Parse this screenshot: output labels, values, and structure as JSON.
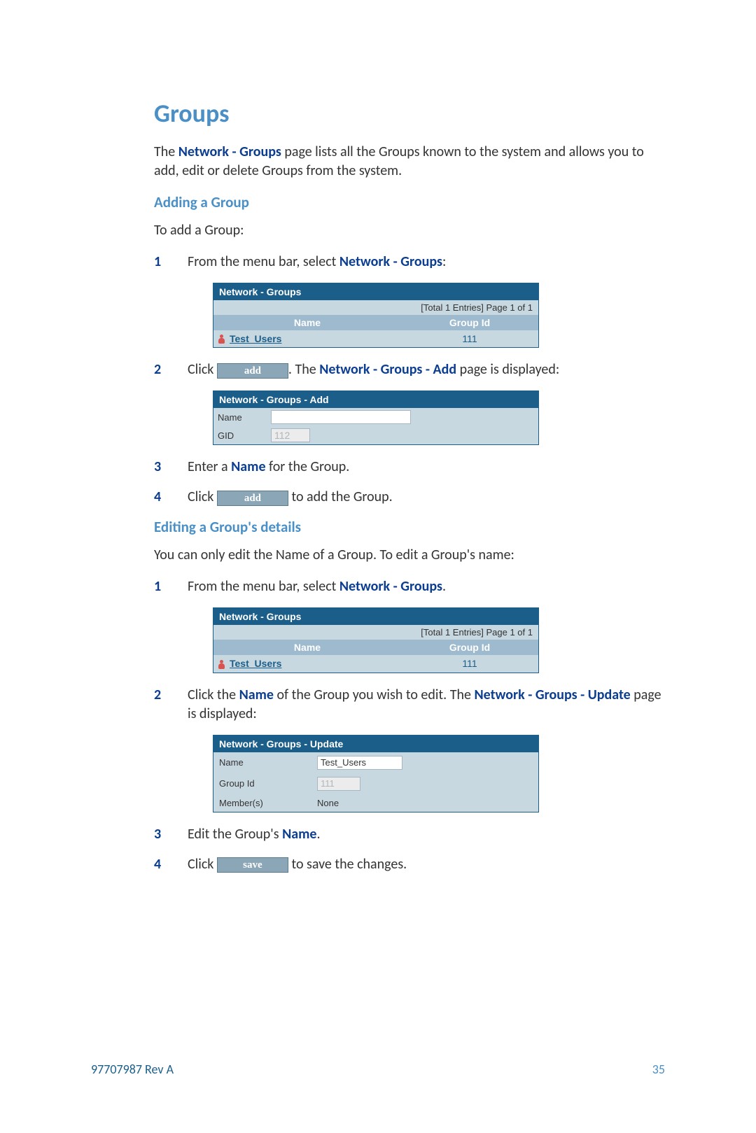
{
  "heading": "Groups",
  "intro": {
    "pre": "The ",
    "bold": "Network - Groups",
    "post": " page lists all the Groups known to the system and allows you to add, edit or delete Groups from the system."
  },
  "adding": {
    "title": "Adding a Group",
    "lead": "To add a Group:",
    "step1": {
      "num": "1",
      "pre": "From the menu bar, select ",
      "bold": "Network - Groups",
      "post": ":"
    },
    "panel1": {
      "title": "Network - Groups",
      "meta": "[Total 1 Entries] Page 1 of 1",
      "col_name": "Name",
      "col_gid": "Group Id",
      "row_name": "Test_Users",
      "row_gid": "111"
    },
    "step2": {
      "num": "2",
      "pre": "Click ",
      "btn": "add",
      "mid": ". The ",
      "bold": "Network - Groups - Add",
      "post": " page is displayed:"
    },
    "panel2": {
      "title": "Network - Groups - Add",
      "name_label": "Name",
      "gid_label": "GID",
      "gid_value": "112"
    },
    "step3": {
      "num": "3",
      "pre": "Enter a ",
      "bold": "Name",
      "post": " for the Group."
    },
    "step4": {
      "num": "4",
      "pre": "Click ",
      "btn": "add",
      "post": " to add the Group."
    }
  },
  "editing": {
    "title": "Editing a Group's details",
    "lead": "You can only edit the Name of a Group. To edit a Group's name:",
    "step1": {
      "num": "1",
      "pre": "From the menu bar, select ",
      "bold": "Network - Groups",
      "post": "."
    },
    "panel1": {
      "title": "Network - Groups",
      "meta": "[Total 1 Entries] Page 1 of 1",
      "col_name": "Name",
      "col_gid": "Group Id",
      "row_name": "Test_Users",
      "row_gid": "111"
    },
    "step2": {
      "num": "2",
      "pre": "Click the ",
      "bold1": "Name",
      "mid": " of the Group you wish to edit. The ",
      "bold2": "Network - Groups - Update",
      "post": " page is displayed:"
    },
    "panel2": {
      "title": "Network - Groups - Update",
      "name_label": "Name",
      "name_value": "Test_Users",
      "gid_label": "Group Id",
      "gid_value": "111",
      "members_label": "Member(s)",
      "members_value": "None"
    },
    "step3": {
      "num": "3",
      "pre": "Edit the Group's ",
      "bold": "Name",
      "post": "."
    },
    "step4": {
      "num": "4",
      "pre": "Click ",
      "btn": "save",
      "post": " to save the changes."
    }
  },
  "footer": {
    "left": "97707987 Rev A",
    "right": "35"
  }
}
